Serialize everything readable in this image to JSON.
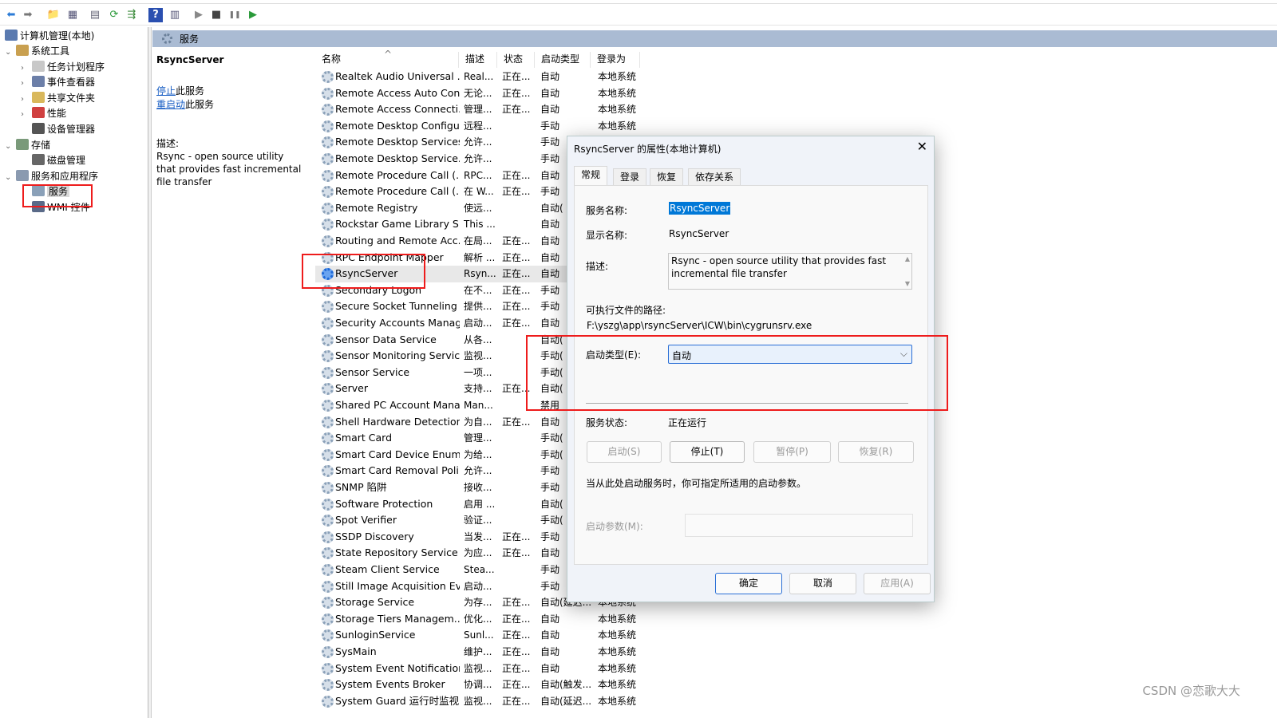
{
  "toolbar": {
    "icons": [
      "back-arrow-icon",
      "forward-arrow-icon",
      "up-folder-icon",
      "show-hide-tree-icon",
      "properties-icon",
      "refresh-icon",
      "export-list-icon",
      "help-icon",
      "action-pane-icon",
      "play-icon",
      "stop-icon",
      "pause-icon",
      "resume-icon"
    ]
  },
  "tree": {
    "root": "计算机管理(本地)",
    "items": [
      {
        "label": "系统工具",
        "level": 0,
        "expanded": true,
        "color": "#c9a050"
      },
      {
        "label": "任务计划程序",
        "level": 1,
        "color": "#c8c8c8"
      },
      {
        "label": "事件查看器",
        "level": 1,
        "color": "#6c7fa8"
      },
      {
        "label": "共享文件夹",
        "level": 1,
        "color": "#d9b85c"
      },
      {
        "label": "性能",
        "level": 1,
        "color": "#d04040"
      },
      {
        "label": "设备管理器",
        "level": 1,
        "color": "#555555"
      },
      {
        "label": "存储",
        "level": 0,
        "expanded": true,
        "color": "#7a9a7a"
      },
      {
        "label": "磁盘管理",
        "level": 1,
        "color": "#666666"
      },
      {
        "label": "服务和应用程序",
        "level": 0,
        "expanded": true,
        "color": "#8a9ab0"
      },
      {
        "label": "服务",
        "level": 1,
        "selected": true,
        "color": "#8aa0b8"
      },
      {
        "label": "WMI 控件",
        "level": 1,
        "color": "#5a6a88"
      }
    ]
  },
  "header": {
    "title": "服务"
  },
  "action": {
    "service_name": "RsyncServer",
    "stop_link": "停止",
    "stop_suffix": "此服务",
    "restart_link": "重启动",
    "restart_suffix": "此服务",
    "desc_label": "描述:",
    "desc": "Rsync - open source utility that provides fast incremental file transfer"
  },
  "list": {
    "columns": [
      "名称",
      "描述",
      "状态",
      "启动类型",
      "登录为"
    ],
    "rows": [
      [
        "Realtek Audio Universal ...",
        "Real...",
        "正在...",
        "自动",
        "本地系统"
      ],
      [
        "Remote Access Auto Con...",
        "无论...",
        "正在...",
        "自动",
        "本地系统"
      ],
      [
        "Remote Access Connecti...",
        "管理...",
        "正在...",
        "自动",
        "本地系统"
      ],
      [
        "Remote Desktop Configu...",
        "远程...",
        "",
        "手动",
        "本地系统"
      ],
      [
        "Remote Desktop Services",
        "允许...",
        "",
        "手动",
        ""
      ],
      [
        "Remote Desktop Service...",
        "允许...",
        "",
        "手动",
        ""
      ],
      [
        "Remote Procedure Call (...",
        "RPC...",
        "正在...",
        "自动",
        ""
      ],
      [
        "Remote Procedure Call (...",
        "在 W...",
        "正在...",
        "手动",
        ""
      ],
      [
        "Remote Registry",
        "使远...",
        "",
        "自动(",
        ""
      ],
      [
        "Rockstar Game Library S...",
        "This ...",
        "",
        "自动",
        ""
      ],
      [
        "Routing and Remote Acc...",
        "在局...",
        "正在...",
        "自动",
        ""
      ],
      [
        "RPC Endpoint Mapper",
        "解析 ...",
        "正在...",
        "自动",
        ""
      ],
      [
        "RsyncServer",
        "Rsyn...",
        "正在...",
        "自动",
        ""
      ],
      [
        "Secondary Logon",
        "在不...",
        "正在...",
        "手动",
        ""
      ],
      [
        "Secure Socket Tunneling ...",
        "提供...",
        "正在...",
        "手动",
        ""
      ],
      [
        "Security Accounts Manag...",
        "启动...",
        "正在...",
        "自动",
        ""
      ],
      [
        "Sensor Data Service",
        "从各...",
        "",
        "自动(",
        ""
      ],
      [
        "Sensor Monitoring Service",
        "监视...",
        "",
        "手动(",
        ""
      ],
      [
        "Sensor Service",
        "一项...",
        "",
        "手动(",
        ""
      ],
      [
        "Server",
        "支持...",
        "正在...",
        "自动(",
        ""
      ],
      [
        "Shared PC Account Mana...",
        "Man...",
        "",
        "禁用",
        ""
      ],
      [
        "Shell Hardware Detection",
        "为自...",
        "正在...",
        "自动",
        ""
      ],
      [
        "Smart Card",
        "管理...",
        "",
        "手动(",
        ""
      ],
      [
        "Smart Card Device Enum...",
        "为给...",
        "",
        "手动(",
        ""
      ],
      [
        "Smart Card Removal Poli...",
        "允许...",
        "",
        "手动",
        ""
      ],
      [
        "SNMP 陷阱",
        "接收...",
        "",
        "手动",
        ""
      ],
      [
        "Software Protection",
        "启用 ...",
        "",
        "自动(",
        ""
      ],
      [
        "Spot Verifier",
        "验证...",
        "",
        "手动(",
        ""
      ],
      [
        "SSDP Discovery",
        "当发...",
        "正在...",
        "手动",
        ""
      ],
      [
        "State Repository Service",
        "为应...",
        "正在...",
        "自动",
        ""
      ],
      [
        "Steam Client Service",
        "Stea...",
        "",
        "手动",
        ""
      ],
      [
        "Still Image Acquisition Ev...",
        "启动...",
        "",
        "手动",
        ""
      ],
      [
        "Storage Service",
        "为存...",
        "正在...",
        "自动(延迟...",
        "本地系统"
      ],
      [
        "Storage Tiers Managem...",
        "优化...",
        "正在...",
        "自动",
        "本地系统"
      ],
      [
        "SunloginService",
        "Sunl...",
        "正在...",
        "自动",
        "本地系统"
      ],
      [
        "SysMain",
        "维护...",
        "正在...",
        "自动",
        "本地系统"
      ],
      [
        "System Event Notification...",
        "监视...",
        "正在...",
        "自动",
        "本地系统"
      ],
      [
        "System Events Broker",
        "协调...",
        "正在...",
        "自动(触发...",
        "本地系统"
      ],
      [
        "System Guard 运行时监视...",
        "监视...",
        "正在...",
        "自动(延迟...",
        "本地系统"
      ]
    ],
    "selected_index": 12
  },
  "dialog": {
    "title": "RsyncServer 的属性(本地计算机)",
    "tabs": [
      "常规",
      "登录",
      "恢复",
      "依存关系"
    ],
    "service_name_label": "服务名称:",
    "service_name": "RsyncServer",
    "display_name_label": "显示名称:",
    "display_name": "RsyncServer",
    "desc_label": "描述:",
    "desc": "Rsync - open source utility that provides fast incremental file transfer",
    "path_label": "可执行文件的路径:",
    "path": "F:\\yszg\\app\\rsyncServer\\ICW\\bin\\cygrunsrv.exe",
    "startup_label": "启动类型(E):",
    "startup_value": "自动",
    "status_label": "服务状态:",
    "status_value": "正在运行",
    "btn_start": "启动(S)",
    "btn_stop": "停止(T)",
    "btn_pause": "暂停(P)",
    "btn_resume": "恢复(R)",
    "hint": "当从此处启动服务时，你可指定所适用的启动参数。",
    "params_label": "启动参数(M):",
    "params_value": "",
    "ok": "确定",
    "cancel": "取消",
    "apply": "应用(A)"
  },
  "watermark": "CSDN @恋歌大大",
  "colors": {
    "highlight": "#0078d7",
    "annotation_red": "#ee1c1c",
    "header_bar": "#aabbd3"
  }
}
